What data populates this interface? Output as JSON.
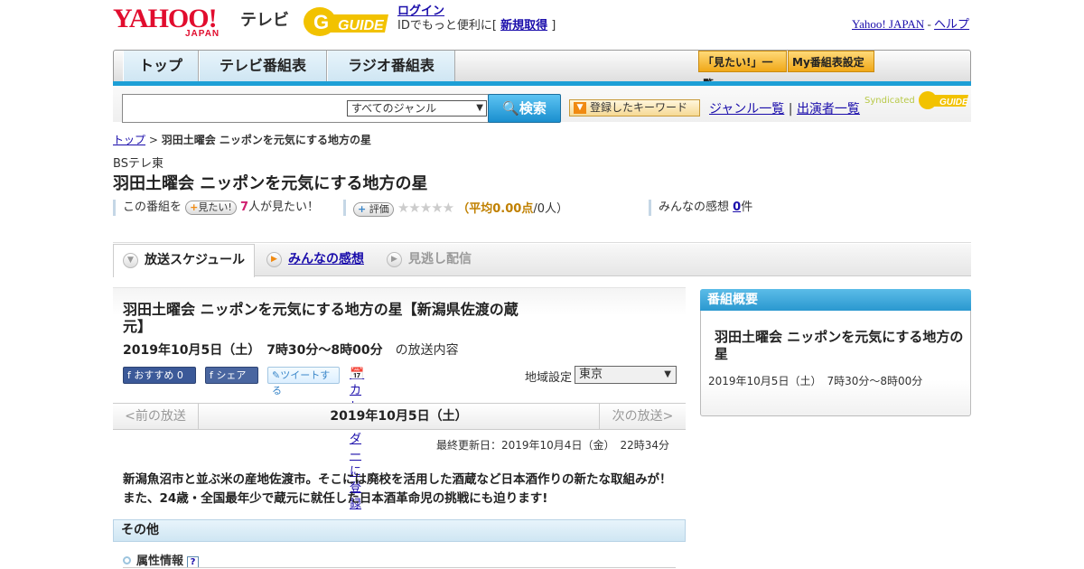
{
  "header": {
    "yahoo_logo": "YAHOO!",
    "japan": "JAPAN",
    "tv_label": "テレビ",
    "gguide_logo": "GUIDE",
    "login": "ログイン",
    "login_sub_prefix": "IDでもっと便利に[ ",
    "register": "新規取得",
    "login_sub_suffix": " ]",
    "yahoo_japan_link": "Yahoo! JAPAN",
    "separator": " - ",
    "help_link": "ヘルプ"
  },
  "nav": {
    "tabs": [
      "トップ",
      "テレビ番組表",
      "ラジオ番組表"
    ],
    "mitai_list": "「見たい!」一覧",
    "my_program": "My番組表設定"
  },
  "search": {
    "genre_selected": "すべてのジャンル",
    "button": "検索",
    "keyword_button": "登録したキーワード",
    "genre_list": "ジャンル一覧",
    "divider": " | ",
    "performer_list": "出演者一覧",
    "syndicated": "Syndicated"
  },
  "breadcrumb": {
    "top": "トップ",
    "sep": " > ",
    "current": "羽田土曜会 ニッポンを元気にする地方の星"
  },
  "program": {
    "channel": "BSテレ東",
    "title": "羽田土曜会 ニッポンを元気にする地方の星",
    "want_prefix": "この番組を",
    "want_pill": "見たい!",
    "want_count": "7",
    "want_suffix": "人が見たい！",
    "rating_pill": "評価",
    "stars": "★★★★★",
    "rating_open": "（平均",
    "rating_avg": "0.00点",
    "rating_close": "/0人）",
    "impressions_prefix": "みんなの感想 ",
    "impressions_count": "0",
    "impressions_suffix": "件"
  },
  "tabs": {
    "schedule": "放送スケジュール",
    "reviews": "みんなの感想",
    "vod": "見逃し配信"
  },
  "episode": {
    "title": "羽田土曜会 ニッポンを元気にする地方の星【新潟県佐渡の蔵元】",
    "time": "2019年10月5日（土）　7時30分～8時00分",
    "time_suffix": "の放送内容",
    "fb_recommend": "おすすめ 0",
    "fb_share": "シェア",
    "tweet": "ツイートする",
    "calendar": "カレンダーに登録",
    "region_label": "地域設定",
    "region_value": "東京",
    "prev": "<前の放送",
    "current_date": "2019年10月5日（土）",
    "next": "次の放送>",
    "updated": "最終更新日：2019年10月4日（金）　22時34分",
    "description": "新潟魚沼市と並ぶ米の産地佐渡市。そこには廃校を活用した酒蔵など日本酒作りの新たな取組みが！また、24歳・全国最年少で蔵元に就任した日本酒革命児の挑戦にも迫ります!",
    "other_heading": "その他",
    "attr_label": "属性情報",
    "attr_help": "?"
  },
  "sidebar": {
    "heading": "番組概要",
    "title": "羽田土曜会 ニッポンを元気にする地方の星",
    "time": "2019年10月5日（土）　7時30分～8時00分"
  },
  "colors": {
    "accent_blue": "#1d9fd6",
    "yahoo_red": "#e10d2e",
    "gguide_yellow": "#f2c200"
  }
}
